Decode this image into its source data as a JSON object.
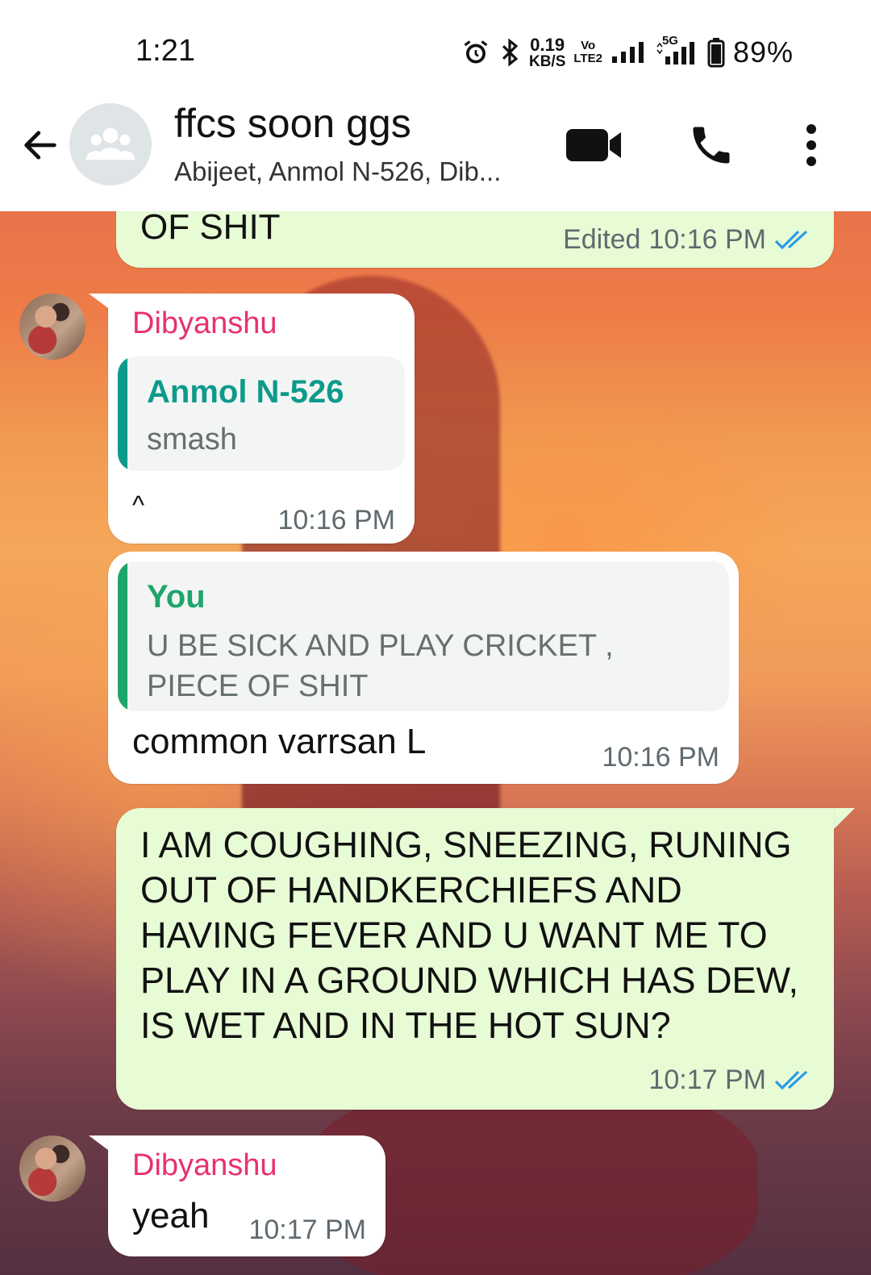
{
  "status_bar": {
    "time": "1:21",
    "net_speed_value": "0.19",
    "net_speed_unit": "KB/S",
    "volte_top": "Vo",
    "volte_bottom": "LTE2",
    "network_5g": "5G",
    "battery": "89%"
  },
  "header": {
    "title": "ffcs soon ggs",
    "subtitle": "Abijeet, Anmol N-526, Dib..."
  },
  "messages": [
    {
      "text": "OF SHIT",
      "edited_label": "Edited",
      "time": "10:16 PM"
    },
    {
      "sender": "Dibyanshu",
      "quote_author": "Anmol N-526",
      "quote_text": "smash",
      "text": "^",
      "time": "10:16 PM"
    },
    {
      "quote_author": "You",
      "quote_text": "U BE SICK AND PLAY CRICKET , PIECE OF SHIT",
      "text": "common varrsan L",
      "time": "10:16 PM"
    },
    {
      "text": "I AM COUGHING, SNEEZING, RUNING OUT OF HANDKERCHIEFS AND HAVING FEVER AND U WANT ME TO PLAY IN A GROUND WHICH HAS DEW, IS WET AND IN THE HOT SUN?",
      "time": "10:17 PM"
    },
    {
      "sender": "Dibyanshu",
      "text": "yeah",
      "time": "10:17 PM"
    }
  ],
  "colors": {
    "outgoing_bubble": "#e7fbd5",
    "incoming_bubble": "#ffffff",
    "sender_name": "#e8306f",
    "quote_anmol": "#0e9a8a",
    "quote_you": "#1ea56a",
    "read_ticks": "#2b9be8"
  }
}
